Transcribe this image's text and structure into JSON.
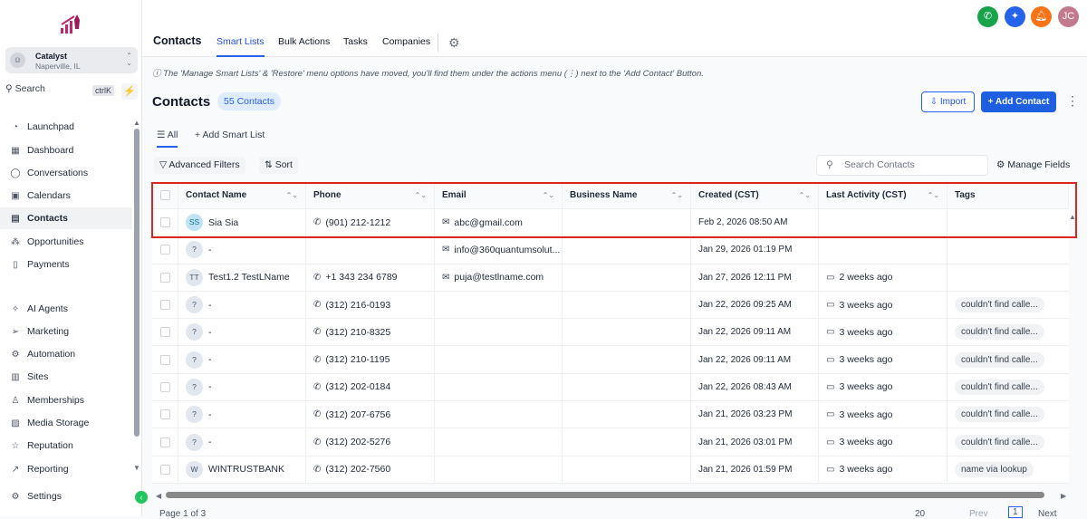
{
  "sidebar": {
    "location_name": "Catalyst",
    "location_sub": "Naperville, IL",
    "search_label": "Search",
    "search_shortcut": "ctrlK",
    "items": [
      {
        "label": "Launchpad",
        "icon": "◔"
      },
      {
        "label": "Dashboard",
        "icon": "▦"
      },
      {
        "label": "Conversations",
        "icon": "◯"
      },
      {
        "label": "Calendars",
        "icon": "▣"
      },
      {
        "label": "Contacts",
        "icon": "▤",
        "active": true
      },
      {
        "label": "Opportunities",
        "icon": "⁂"
      },
      {
        "label": "Payments",
        "icon": "▯"
      },
      {
        "label": "AI Agents",
        "icon": "✧"
      },
      {
        "label": "Marketing",
        "icon": "➢"
      },
      {
        "label": "Automation",
        "icon": "⚙"
      },
      {
        "label": "Sites",
        "icon": "▥"
      },
      {
        "label": "Memberships",
        "icon": "♙"
      },
      {
        "label": "Media Storage",
        "icon": "▨"
      },
      {
        "label": "Reputation",
        "icon": "☆"
      },
      {
        "label": "Reporting",
        "icon": "↗"
      },
      {
        "label": "Settings",
        "icon": "⚙"
      }
    ]
  },
  "header": {
    "title": "Contacts",
    "tabs": [
      "Smart Lists",
      "Bulk Actions",
      "Tasks",
      "Companies"
    ],
    "user_initials": "JC",
    "colors": {
      "phone": "#16a34a",
      "ai": "#2563eb",
      "bell": "#f97316",
      "avatar": "#c47a8e"
    }
  },
  "notice": "ⓘ The 'Manage Smart Lists' & 'Restore' menu options have moved, you'll find them under the actions menu (⋮) next to the 'Add Contact' Button.",
  "page": {
    "title": "Contacts",
    "count_badge": "55 Contacts",
    "import_label": "Import",
    "add_label": "+ Add Contact"
  },
  "smart_lists": {
    "all": "All",
    "add": "+ Add Smart List"
  },
  "toolbar": {
    "filters": "Advanced Filters",
    "sort": "Sort",
    "search_placeholder": "Search Contacts",
    "manage_fields": "Manage Fields"
  },
  "table": {
    "columns": [
      "Contact Name",
      "Phone",
      "Email",
      "Business Name",
      "Created (CST)",
      "Last Activity (CST)",
      "Tags"
    ],
    "rows": [
      {
        "initials": "SS",
        "name": "Sia Sia",
        "phone": "(901) 212-1212",
        "email": "abc@gmail.com",
        "business": "",
        "created": "Feb 2, 2026 08:50 AM",
        "activity": "",
        "tag": ""
      },
      {
        "initials": "?",
        "name": "-",
        "phone": "",
        "email": "info@360quantumsolut...",
        "business": "",
        "created": "Jan 29, 2026 01:19 PM",
        "activity": "",
        "tag": ""
      },
      {
        "initials": "TT",
        "name": "Test1.2 TestLName",
        "phone": "+1 343 234 6789",
        "email": "puja@testlname.com",
        "business": "",
        "created": "Jan 27, 2026 12:11 PM",
        "activity": "2 weeks ago",
        "tag": ""
      },
      {
        "initials": "?",
        "name": "-",
        "phone": "(312) 216-0193",
        "email": "",
        "business": "",
        "created": "Jan 22, 2026 09:25 AM",
        "activity": "3 weeks ago",
        "tag": "couldn't find calle..."
      },
      {
        "initials": "?",
        "name": "-",
        "phone": "(312) 210-8325",
        "email": "",
        "business": "",
        "created": "Jan 22, 2026 09:11 AM",
        "activity": "3 weeks ago",
        "tag": "couldn't find calle..."
      },
      {
        "initials": "?",
        "name": "-",
        "phone": "(312) 210-1195",
        "email": "",
        "business": "",
        "created": "Jan 22, 2026 09:11 AM",
        "activity": "3 weeks ago",
        "tag": "couldn't find calle..."
      },
      {
        "initials": "?",
        "name": "-",
        "phone": "(312) 202-0184",
        "email": "",
        "business": "",
        "created": "Jan 22, 2026 08:43 AM",
        "activity": "3 weeks ago",
        "tag": "couldn't find calle..."
      },
      {
        "initials": "?",
        "name": "-",
        "phone": "(312) 207-6756",
        "email": "",
        "business": "",
        "created": "Jan 21, 2026 03:23 PM",
        "activity": "3 weeks ago",
        "tag": "couldn't find calle..."
      },
      {
        "initials": "?",
        "name": "-",
        "phone": "(312) 202-5276",
        "email": "",
        "business": "",
        "created": "Jan 21, 2026 03:01 PM",
        "activity": "3 weeks ago",
        "tag": "couldn't find calle..."
      },
      {
        "initials": "W",
        "name": "WINTRUSTBANK",
        "phone": "(312) 202-7560",
        "email": "",
        "business": "",
        "created": "Jan 21, 2026 01:59 PM",
        "activity": "3 weeks ago",
        "tag": "name via lookup"
      }
    ]
  },
  "pagination": {
    "page_text": "Page 1 of 3",
    "page_size": "20",
    "prev": "Prev",
    "current": "1",
    "next": "Next"
  }
}
